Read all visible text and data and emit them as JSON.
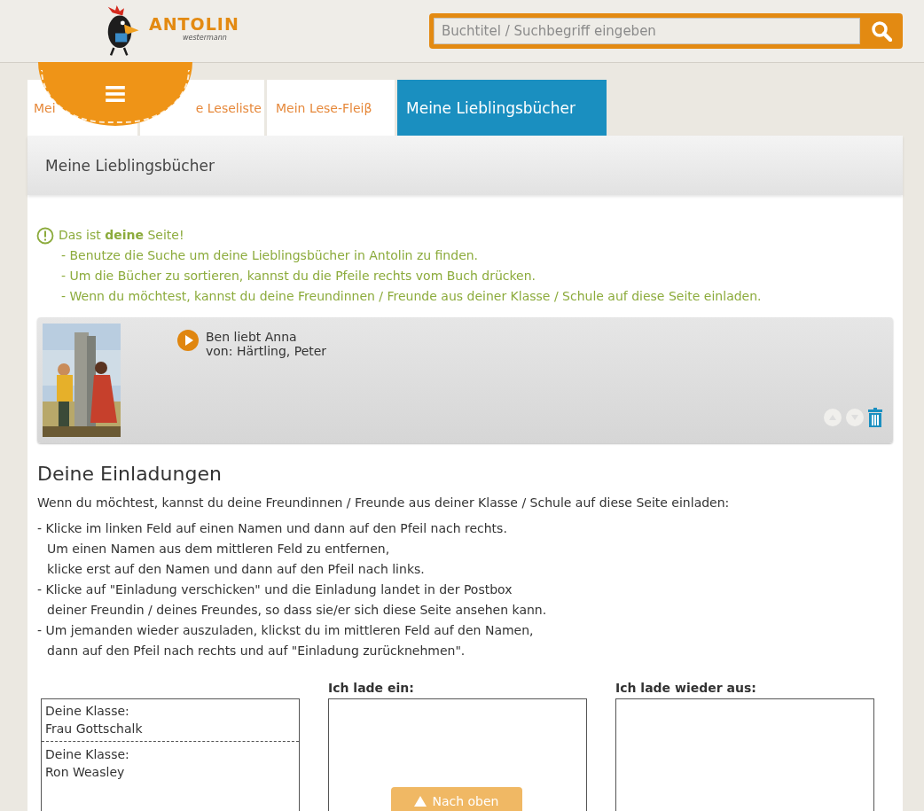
{
  "header": {
    "logo_text": "ANTOLIN",
    "logo_subtext": "westermann",
    "search": {
      "placeholder": "Buchtitel / Suchbegriff eingeben"
    }
  },
  "tabs": [
    {
      "label": "Mei",
      "selected": false
    },
    {
      "label": "e Leseliste",
      "selected": false
    },
    {
      "label": "Mein Lese-Fleiβ",
      "selected": false
    },
    {
      "label": "Meine Lieblingsbücher",
      "selected": true
    }
  ],
  "page_title": "Meine Lieblingsbücher",
  "notice": {
    "heading": "Das ist **deine** Seite!",
    "lines": [
      "- Benutze die Suche um deine Lieblingsbücher in Antolin zu finden.",
      "- Um die Bücher zu sortieren, kannst du die Pfeile rechts vom Buch drücken.",
      "- Wenn du möchtest, kannst du deine Freundinnen / Freunde aus deiner Klasse / Schule auf diese Seite einladen."
    ]
  },
  "books": [
    {
      "title": "Ben liebt Anna",
      "author": "von: Härtling, Peter"
    }
  ],
  "invitations": {
    "heading": "Deine Einladungen",
    "intro": "Wenn du möchtest, kannst du deine Freundinnen / Freunde aus deiner Klasse / Schule auf diese Seite einladen:",
    "steps": [
      {
        "text": "- Klicke im linken Feld auf einen Namen und dann auf den Pfeil nach rechts.",
        "kind": "first"
      },
      {
        "text": "Um einen Namen aus dem mittleren Feld zu entfernen,",
        "kind": "cont"
      },
      {
        "text": "klicke erst auf den Namen und dann auf den Pfeil nach links.",
        "kind": "cont"
      },
      {
        "text": "- Klicke auf \"Einladung verschicken\" und die Einladung landet in der Postbox",
        "kind": "first"
      },
      {
        "text": "deiner Freundin / deines Freundes, so dass sie/er sich diese Seite ansehen kann.",
        "kind": "cont"
      },
      {
        "text": "- Um jemanden wieder auszuladen, klickst du im mittleren Feld auf den Namen,",
        "kind": "first"
      },
      {
        "text": "dann auf den Pfeil nach rechts und auf \"Einladung zurücknehmen\".",
        "kind": "cont"
      }
    ],
    "lists": [
      {
        "entries": [
          {
            "group": "Deine Klasse:",
            "name": "Frau Gottschalk"
          },
          {
            "group": "Deine Klasse:",
            "name": "Ron Weasley"
          }
        ]
      },
      {
        "label": "Ich lade ein:"
      },
      {
        "label": "Ich lade wieder aus:"
      }
    ]
  },
  "back_to_top": "Nach oben"
}
